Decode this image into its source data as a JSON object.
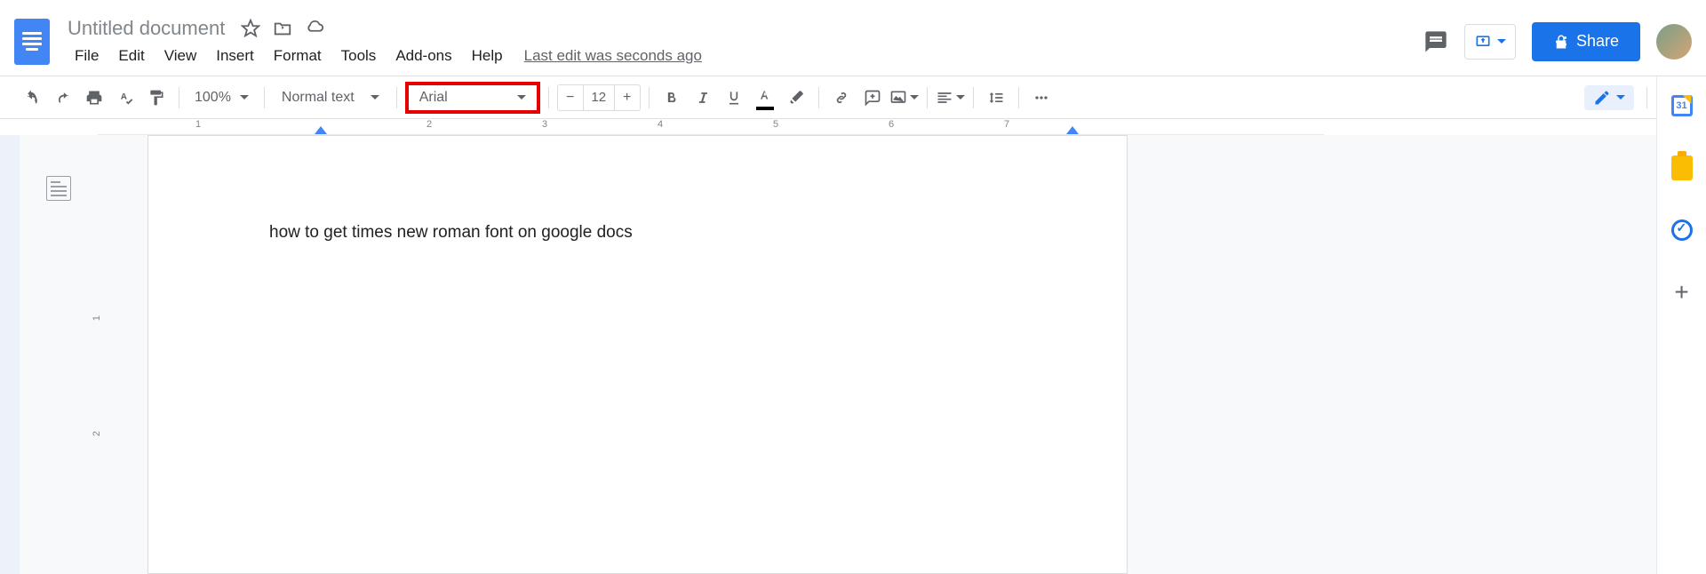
{
  "header": {
    "title": "Untitled document",
    "menu": [
      "File",
      "Edit",
      "View",
      "Insert",
      "Format",
      "Tools",
      "Add-ons",
      "Help"
    ],
    "last_edit": "Last edit was seconds ago",
    "share_label": "Share"
  },
  "toolbar": {
    "zoom": "100%",
    "style": "Normal text",
    "font": "Arial",
    "font_size": "12"
  },
  "ruler": {
    "marks": [
      "1",
      "2",
      "3",
      "4",
      "5",
      "6",
      "7"
    ]
  },
  "document": {
    "text": "how to get times new roman font on google docs"
  },
  "vruler": {
    "marks": [
      "1",
      "2"
    ]
  },
  "sidepanel": {
    "calendar_day": "31"
  }
}
